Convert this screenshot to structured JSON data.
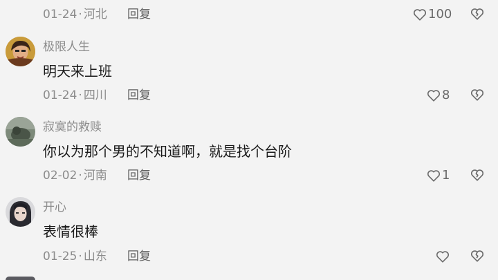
{
  "comments": [
    {
      "username": "",
      "content": "",
      "date": "01-24",
      "location": "河北",
      "reply": "回复",
      "likes": "100"
    },
    {
      "username": "极限人生",
      "content": "明天来上班",
      "date": "01-24",
      "location": "四川",
      "reply": "回复",
      "likes": "8"
    },
    {
      "username": "寂寞的救赎",
      "content": "你以为那个男的不知道啊，就是找个台阶",
      "date": "02-02",
      "location": "河南",
      "reply": "回复",
      "likes": "1"
    },
    {
      "username": "开心",
      "content": "表情很棒",
      "date": "01-25",
      "location": "山东",
      "reply": "回复",
      "likes": ""
    }
  ],
  "icons": {
    "like": "heart-outline-icon",
    "dislike": "broken-heart-icon"
  },
  "colors": {
    "background": "#f3f3f3",
    "text": "#1a1a1a",
    "muted": "#8c8c8c",
    "icon": "#6a6a6a"
  }
}
